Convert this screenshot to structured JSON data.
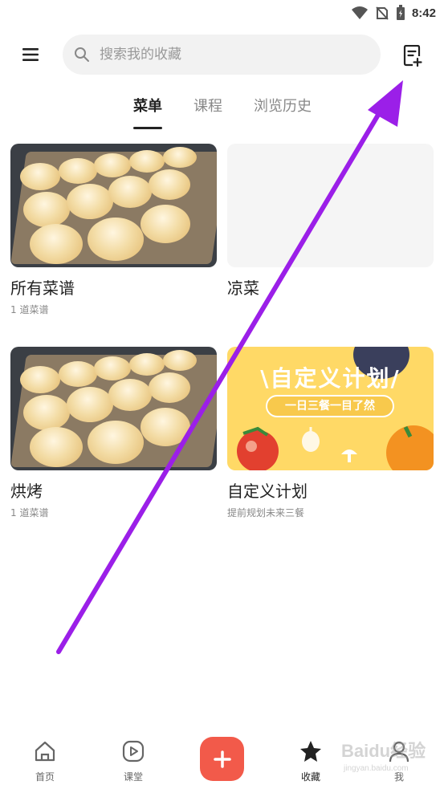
{
  "status_bar": {
    "time": "8:42"
  },
  "header": {
    "search_placeholder": "搜索我的收藏"
  },
  "tabs": [
    {
      "label": "菜单",
      "active": true
    },
    {
      "label": "课程",
      "active": false
    },
    {
      "label": "浏览历史",
      "active": false
    }
  ],
  "cards": [
    {
      "title": "所有菜谱",
      "subtitle": "1 道菜谱"
    },
    {
      "title": "凉菜",
      "subtitle": ""
    },
    {
      "title": "烘烤",
      "subtitle": "1 道菜谱"
    },
    {
      "title": "自定义计划",
      "subtitle": "提前规划未来三餐"
    }
  ],
  "plan_card": {
    "banner": "\\自定义计划/",
    "tagline": "一日三餐一目了然"
  },
  "bottom_nav": {
    "home": "首页",
    "class": "课堂",
    "favorites": "收藏",
    "me": "我"
  },
  "watermark": {
    "text": "Baidu经验",
    "sub": "jingyan.baidu.com"
  },
  "colors": {
    "accent": "#f25a4a",
    "arrow": "#9b1fe8",
    "search_bg": "#f2f2f2"
  }
}
